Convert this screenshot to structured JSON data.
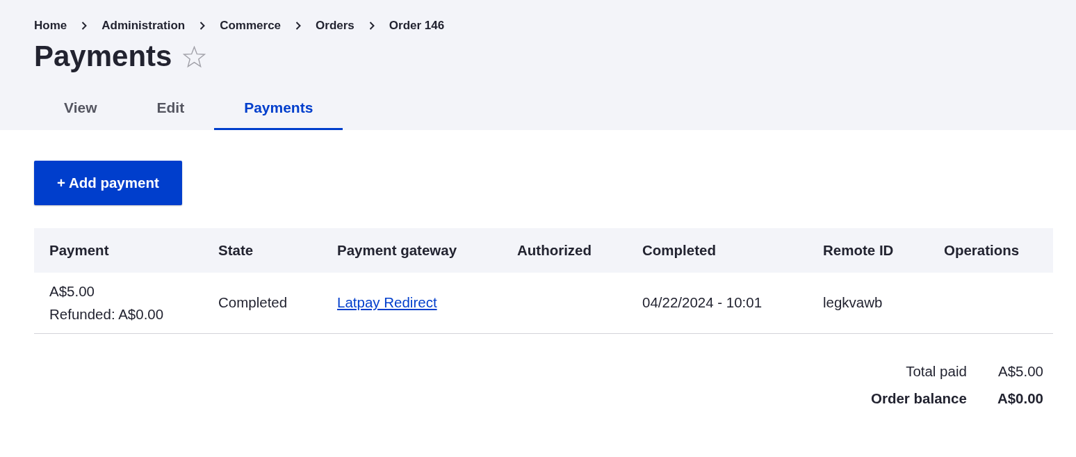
{
  "breadcrumb": [
    {
      "label": "Home"
    },
    {
      "label": "Administration"
    },
    {
      "label": "Commerce"
    },
    {
      "label": "Orders"
    },
    {
      "label": "Order 146"
    }
  ],
  "page_title": "Payments",
  "starred": false,
  "tabs": [
    {
      "label": "View",
      "selected": false
    },
    {
      "label": "Edit",
      "selected": false
    },
    {
      "label": "Payments",
      "selected": true
    }
  ],
  "action_button": "+ Add payment",
  "table": {
    "columns": [
      "Payment",
      "State",
      "Payment gateway",
      "Authorized",
      "Completed",
      "Remote ID",
      "Operations"
    ],
    "rows": [
      {
        "cells": [
          {
            "kind": "amount",
            "lines": [
              "A$5.00",
              "Refunded: A$0.00"
            ]
          },
          {
            "kind": "text",
            "text": "Completed"
          },
          {
            "kind": "link",
            "text": "Latpay Redirect"
          },
          null,
          {
            "kind": "text",
            "text": "04/22/2024 - 10:01"
          },
          {
            "kind": "text",
            "text": "legkvawb"
          },
          null
        ]
      }
    ]
  },
  "totals": [
    {
      "label": "Total paid",
      "value": "A$5.00",
      "emphasis": false
    },
    {
      "label": "Order balance",
      "value": "A$0.00",
      "emphasis": true
    }
  ]
}
